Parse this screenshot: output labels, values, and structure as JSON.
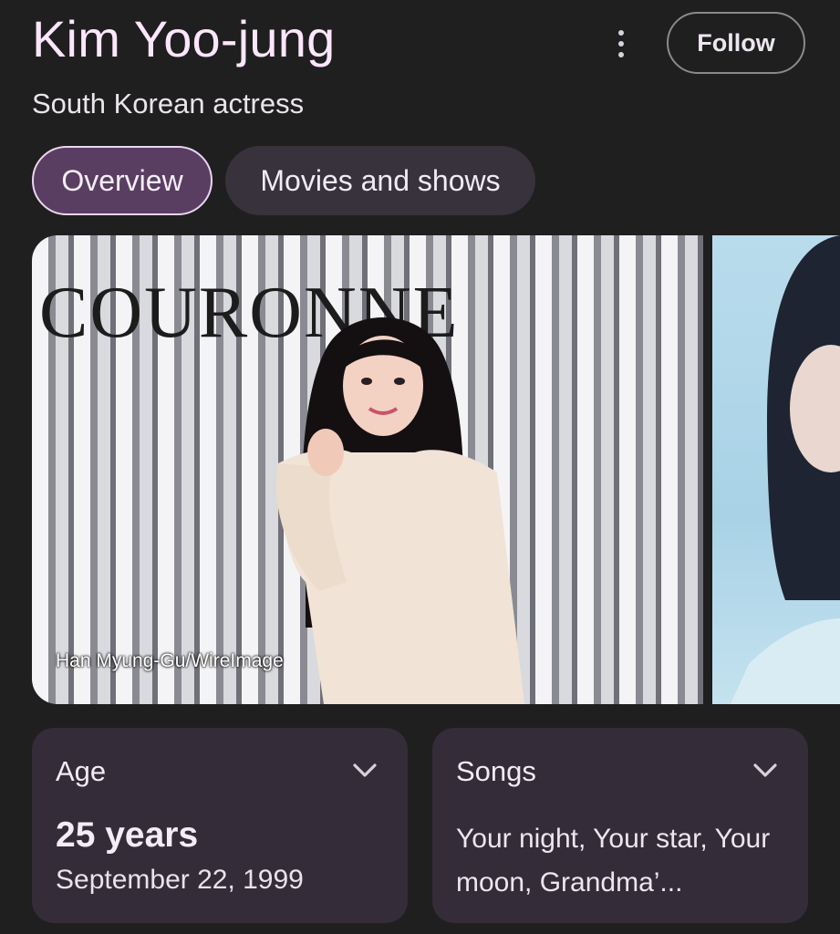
{
  "header": {
    "title": "Kim Yoo-jung",
    "subtitle": "South Korean actress",
    "follow_label": "Follow",
    "more_icon": "more-vert-icon"
  },
  "tabs": [
    {
      "label": "Overview",
      "selected": true
    },
    {
      "label": "Movies and shows",
      "selected": false
    }
  ],
  "images": {
    "main_sign_text": "COURONNE",
    "main_credit": "Han Myung-Gu/WireImage"
  },
  "cards": {
    "age": {
      "label": "Age",
      "value": "25 years",
      "date": "September 22, 1999",
      "icon": "chevron-down-icon"
    },
    "songs": {
      "label": "Songs",
      "text": "Your night, Your star, Your moon, Grandma’...",
      "icon": "chevron-down-icon"
    }
  },
  "colors": {
    "background": "#1f1f1f",
    "card_background": "#342c38",
    "selected_tab": "#5a3e62",
    "title_color": "#fbe6fb"
  }
}
